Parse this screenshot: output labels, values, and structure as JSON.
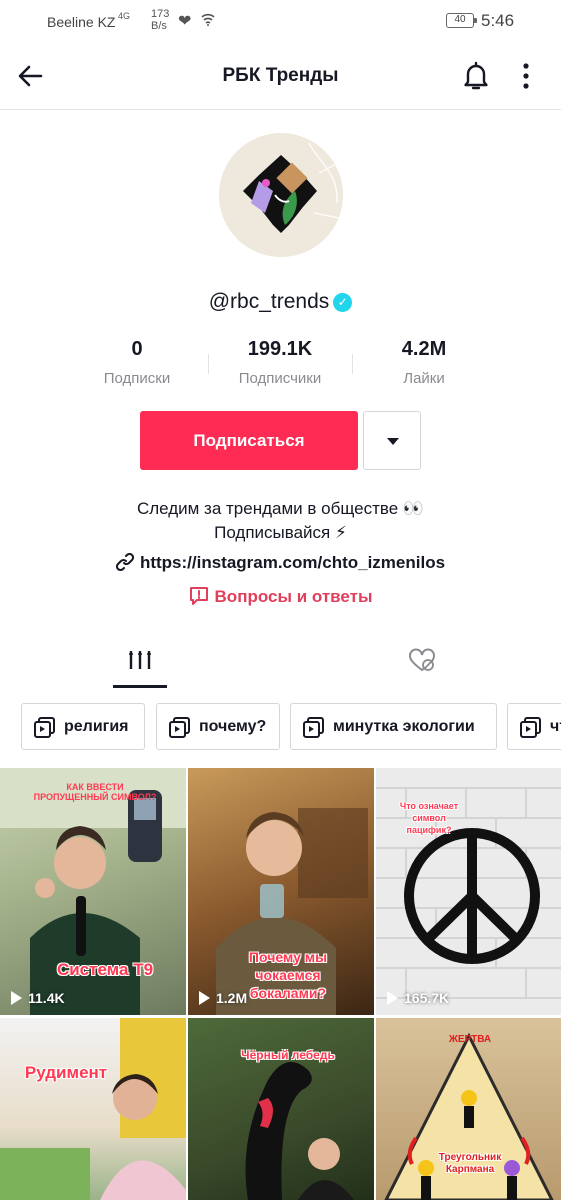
{
  "status_bar": {
    "carrier": "Beeline KZ",
    "signal": "4G",
    "speed_value": "173",
    "speed_unit": "B/s",
    "battery": "40",
    "time": "5:46"
  },
  "header": {
    "title": "РБК Тренды",
    "back_icon": "arrow-left-icon",
    "bell_icon": "bell-icon",
    "more_icon": "more-vertical-icon"
  },
  "profile": {
    "username": "@rbc_trends",
    "verified_icon": "verified-check-icon",
    "stats": [
      {
        "value": "0",
        "label": "Подписки"
      },
      {
        "value": "199.1K",
        "label": "Подписчики"
      },
      {
        "value": "4.2M",
        "label": "Лайки"
      }
    ],
    "follow_label": "Подписаться",
    "bio_line1": "Следим за трендами в обществе 👀",
    "bio_line2": "Подписывайся ⚡",
    "link": "https://instagram.com/chto_izmenilos",
    "qa_label": "Вопросы и ответы",
    "accent_color": "#fe2c55"
  },
  "tabs": {
    "videos_icon": "grid-icon",
    "liked_icon": "heart-hidden-icon"
  },
  "playlists": [
    {
      "label": "религия"
    },
    {
      "label": "почему?"
    },
    {
      "label": "минутка экологии"
    },
    {
      "label": "чт"
    }
  ],
  "videos": [
    {
      "caption": "Система Т9",
      "top_caption": "КАК ВВЕСТИ ПРОПУЩЕННЫЙ СИМВОЛ?",
      "views": "11.4K"
    },
    {
      "caption": "Почему мы чокаемся бокалами?",
      "views": "1.2M"
    },
    {
      "top_caption": "Что означает символ пацифик?",
      "views": "165.7K"
    },
    {
      "caption": "Рудимент"
    },
    {
      "caption": "Чёрный лебедь"
    },
    {
      "top_caption": "ЖЕРТВА",
      "caption": "Треугольник Карпмана"
    }
  ]
}
